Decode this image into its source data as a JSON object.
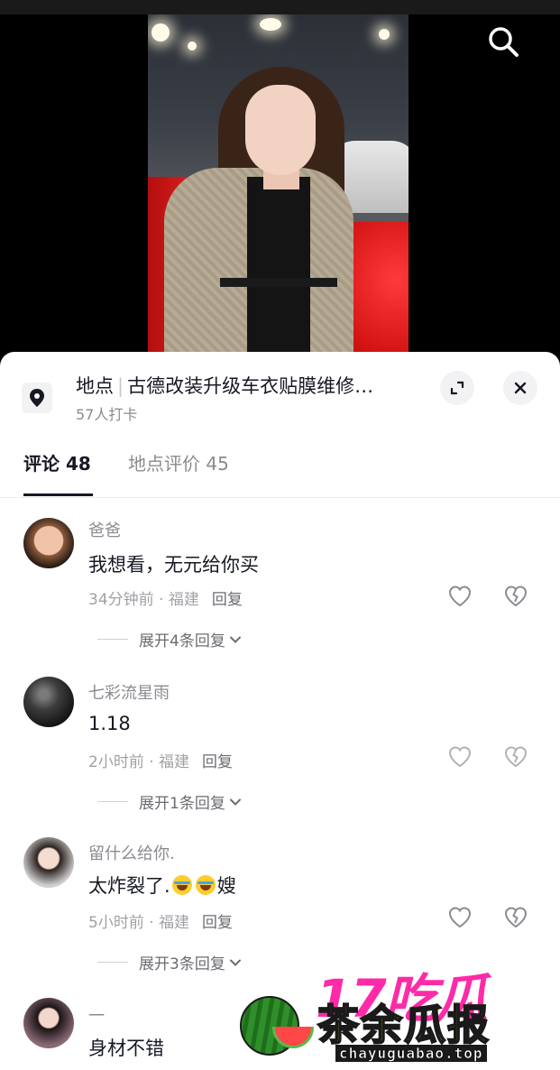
{
  "video": {
    "search_icon": "search-icon"
  },
  "location": {
    "label": "地点",
    "name": "古德改装升级车衣贴膜维修…",
    "checkins": "57人打卡"
  },
  "tabs": [
    {
      "label": "评论 48",
      "active": true
    },
    {
      "label": "地点评价 45",
      "active": false
    }
  ],
  "comments": [
    {
      "user": "爸爸",
      "text": "我想看，无元给你买",
      "time": "34分钟前 · 福建",
      "reply": "回复",
      "expand": "展开4条回复"
    },
    {
      "user": "七彩流星雨",
      "text": "1.18",
      "time": "2小时前 · 福建",
      "reply": "回复",
      "expand": "展开1条回复"
    },
    {
      "user": "留什么给你.",
      "text_before": "太炸裂了.",
      "text_after": "嫂",
      "time": "5小时前 · 福建",
      "reply": "回复",
      "expand": "展开3条回复"
    },
    {
      "user": "一",
      "text": "身材不错"
    }
  ],
  "watermark": {
    "brand_top": "17吃瓜",
    "brand_main": "茶余瓜报",
    "url": "chayuguabao.top"
  },
  "colors": {
    "text_primary": "#161823",
    "text_secondary": "#8a8b91",
    "watermark_pink": "#ff2aa8",
    "watermark_yellow": "#ffe23d"
  }
}
